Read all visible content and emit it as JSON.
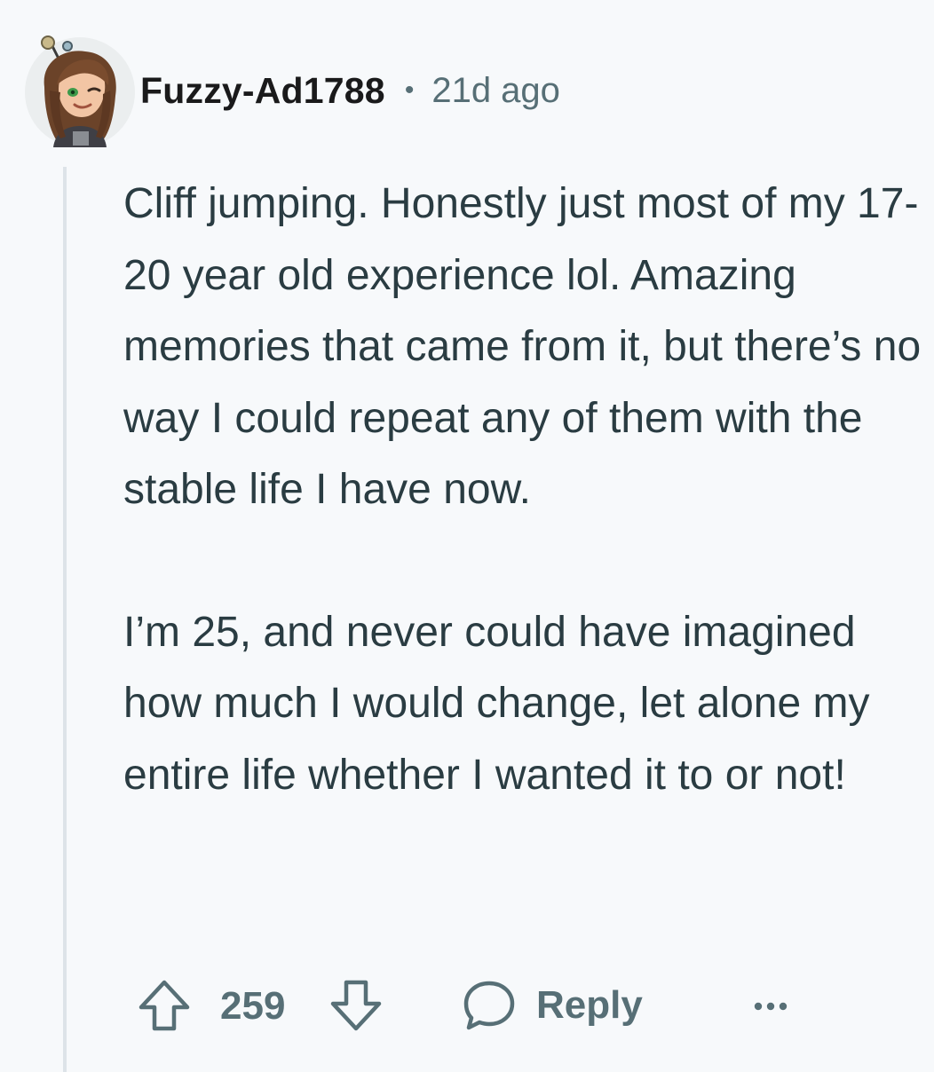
{
  "comment": {
    "username": "Fuzzy-Ad1788",
    "separator": "•",
    "time_ago": "21d ago",
    "paragraphs": [
      "Cliff jumping. Honestly just most of my 17-20 year old experience lol. Amazing memories that came from it, but there’s no way I could repeat any of them with the stable life I have now.",
      "I’m 25, and never could have imagined how much I would change, let alone my entire life whether I wanted it to or not!"
    ],
    "score": "259",
    "reply_label": "Reply"
  },
  "icons": {
    "upvote": "arrow-up-outline-icon",
    "downvote": "arrow-down-outline-icon",
    "reply": "speech-bubble-icon",
    "more": "ellipsis-icon"
  },
  "colors": {
    "background": "#f7f9fb",
    "text": "#2a3c42",
    "meta": "#576f76",
    "thread_line": "#dde3e8"
  }
}
